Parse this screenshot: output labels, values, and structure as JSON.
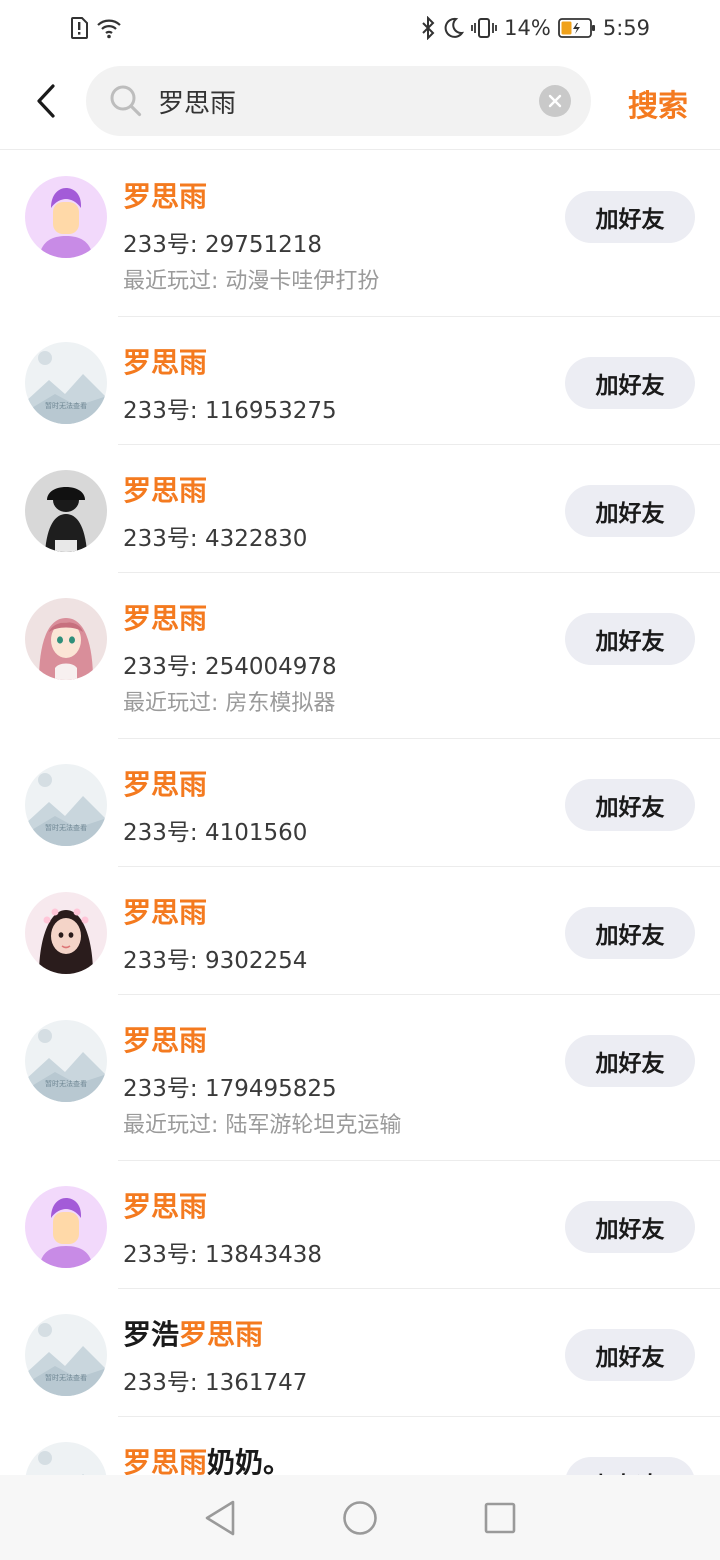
{
  "status_bar": {
    "battery": "14%",
    "time": "5:59",
    "left_icons": [
      "sim-alert-icon",
      "wifi-icon"
    ],
    "right_icons": [
      "bluetooth-icon",
      "moon-icon",
      "vibrate-icon",
      "battery-icon"
    ]
  },
  "search": {
    "query": "罗思雨",
    "action_label": "搜索"
  },
  "results": [
    {
      "name_plain_prefix": "",
      "name_highlight": "罗思雨",
      "name_plain_suffix": "",
      "uid": "233号: 29751218",
      "recent": "最近玩过: 动漫卡哇伊打扮",
      "add_label": "加好友",
      "avatar": "default-purple"
    },
    {
      "name_plain_prefix": "",
      "name_highlight": "罗思雨",
      "name_plain_suffix": "",
      "uid": "233号: 116953275",
      "recent": "",
      "add_label": "加好友",
      "avatar": "placeholder"
    },
    {
      "name_plain_prefix": "",
      "name_highlight": "罗思雨",
      "name_plain_suffix": "",
      "uid": "233号: 4322830",
      "recent": "",
      "add_label": "加好友",
      "avatar": "photo-dark"
    },
    {
      "name_plain_prefix": "",
      "name_highlight": "罗思雨",
      "name_plain_suffix": "",
      "uid": "233号: 254004978",
      "recent": "最近玩过: 房东模拟器",
      "add_label": "加好友",
      "avatar": "anime"
    },
    {
      "name_plain_prefix": "",
      "name_highlight": "罗思雨",
      "name_plain_suffix": "",
      "uid": "233号: 4101560",
      "recent": "",
      "add_label": "加好友",
      "avatar": "placeholder"
    },
    {
      "name_plain_prefix": "",
      "name_highlight": "罗思雨",
      "name_plain_suffix": "",
      "uid": "233号: 9302254",
      "recent": "",
      "add_label": "加好友",
      "avatar": "photo-girl"
    },
    {
      "name_plain_prefix": "",
      "name_highlight": "罗思雨",
      "name_plain_suffix": "",
      "uid": "233号: 179495825",
      "recent": "最近玩过: 陆军游轮坦克运输",
      "add_label": "加好友",
      "avatar": "placeholder"
    },
    {
      "name_plain_prefix": "",
      "name_highlight": "罗思雨",
      "name_plain_suffix": "",
      "uid": "233号: 13843438",
      "recent": "",
      "add_label": "加好友",
      "avatar": "default-purple"
    },
    {
      "name_plain_prefix": "罗浩",
      "name_highlight": "罗思雨",
      "name_plain_suffix": "",
      "uid": "233号: 1361747",
      "recent": "",
      "add_label": "加好友",
      "avatar": "placeholder"
    },
    {
      "name_plain_prefix": "",
      "name_highlight": "罗思雨",
      "name_plain_suffix": "奶奶。",
      "uid": "",
      "recent": "",
      "add_label": "加好友",
      "avatar": "placeholder"
    }
  ],
  "placeholder_avatar_text": "暂时无法查看",
  "colors": {
    "accent": "#f47a1f",
    "button_bg": "#ecedf3",
    "search_bg": "#f2f2f2"
  }
}
